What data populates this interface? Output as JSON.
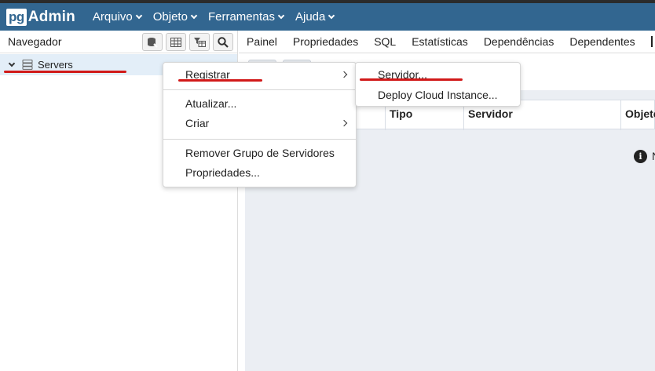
{
  "app": {
    "logo_badge": "pg",
    "logo_text": "Admin"
  },
  "navbar": {
    "menus": [
      {
        "label": "Arquivo"
      },
      {
        "label": "Objeto"
      },
      {
        "label": "Ferramentas"
      },
      {
        "label": "Ajuda"
      }
    ]
  },
  "browser": {
    "title": "Navegador",
    "toolbar_icons": [
      "query-tool-icon",
      "view-data-icon",
      "filtered-rows-icon",
      "search-objects-icon"
    ],
    "tree": [
      {
        "label": "Servers",
        "expanded": true,
        "icon": "servers-icon"
      }
    ]
  },
  "main": {
    "tabs": [
      {
        "label": "Painel"
      },
      {
        "label": "Propriedades"
      },
      {
        "label": "SQL"
      },
      {
        "label": "Estatísticas"
      },
      {
        "label": "Dependências"
      },
      {
        "label": "Dependentes"
      }
    ],
    "grid_columns": [
      "Tipo",
      "Servidor",
      "Objeto"
    ],
    "info_text": "N"
  },
  "context_menu": {
    "items": [
      {
        "label": "Registrar",
        "has_submenu": true
      },
      {
        "label": "Atualizar..."
      },
      {
        "label": "Criar",
        "has_submenu": true
      },
      {
        "label": "Remover Grupo de Servidores"
      },
      {
        "label": "Propriedades..."
      }
    ]
  },
  "submenu": {
    "items": [
      {
        "label": "Servidor..."
      },
      {
        "label": "Deploy Cloud Instance..."
      }
    ]
  },
  "colors": {
    "navbar": "#326690",
    "selected_row": "#e3eef8",
    "annotation_red": "#d11919",
    "content_bg": "#ebeef3"
  }
}
